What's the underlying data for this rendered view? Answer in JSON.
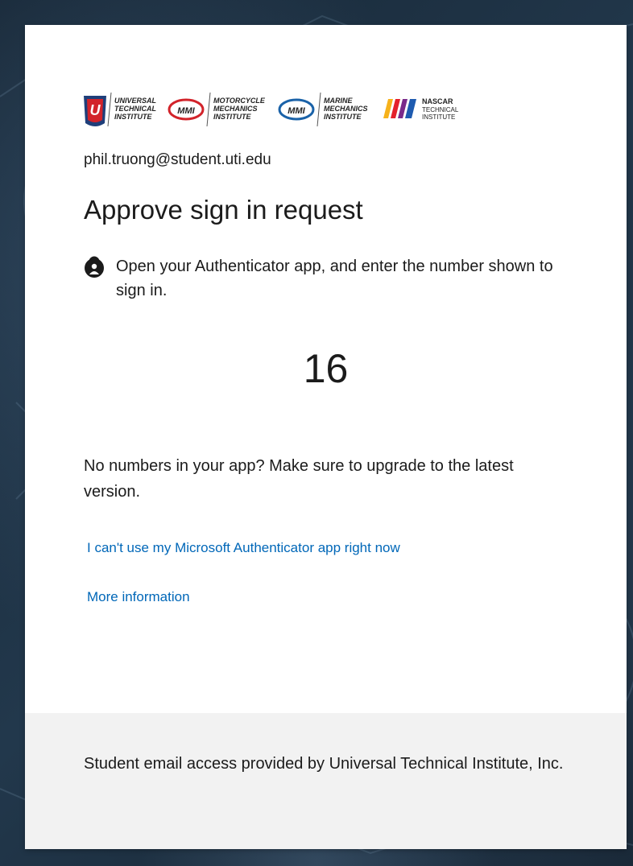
{
  "account": {
    "username": "phil.truong@student.uti.edu"
  },
  "logos": {
    "uti": [
      "UNIVERSAL",
      "TECHNICAL",
      "INSTITUTE"
    ],
    "mmi_badge": "MMI",
    "motorcycle": [
      "MOTORCYCLE",
      "MECHANICS",
      "INSTITUTE"
    ],
    "marine": [
      "MARINE",
      "MECHANICS",
      "INSTITUTE"
    ],
    "nascar": [
      "NASCAR",
      "TECHNICAL",
      "INSTITUTE"
    ]
  },
  "main": {
    "title": "Approve sign in request",
    "instruction": "Open your Authenticator app, and enter the number shown to sign in.",
    "number": "16",
    "upgrade_text": "No numbers in your app? Make sure to upgrade to the latest version.",
    "cant_use_link": "I can't use my Microsoft Authenticator app right now",
    "more_info_link": "More information"
  },
  "footer": {
    "text": "Student email access provided by Universal Technical Institute, Inc."
  },
  "colors": {
    "link": "#0067b8",
    "text": "#1b1b1b",
    "footer_bg": "#f2f2f2",
    "uti_red": "#d2232a",
    "uti_blue": "#1f3f7a",
    "mmi_blue": "#1a62a8"
  },
  "icons": {
    "instruction_icon": "lock-person-icon"
  }
}
